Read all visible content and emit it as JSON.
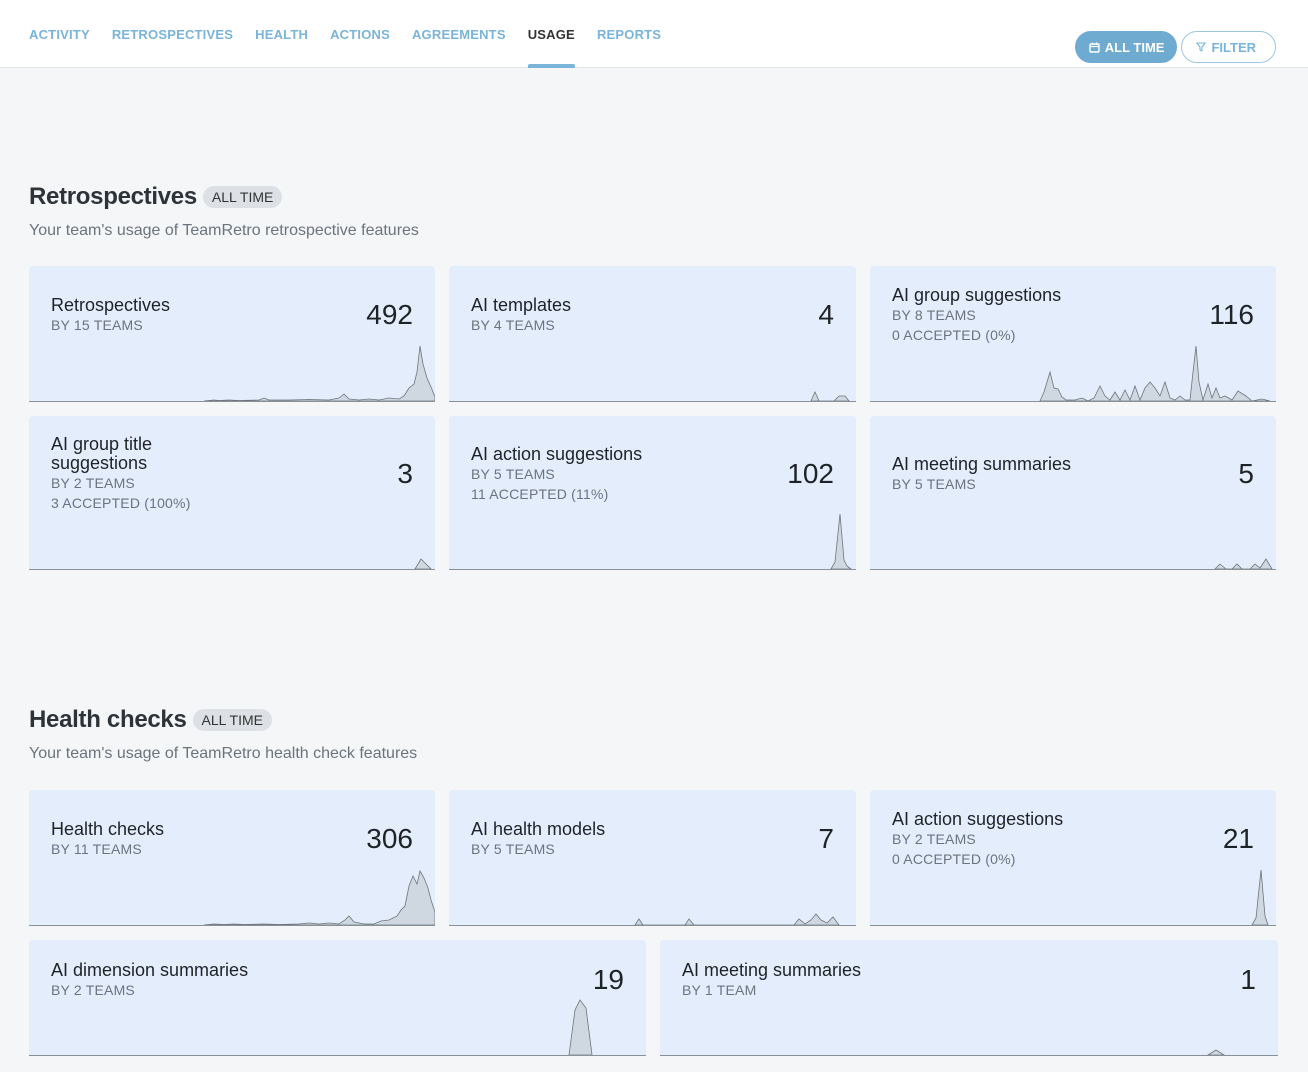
{
  "nav": {
    "tabs": [
      {
        "label": "ACTIVITY",
        "active": false
      },
      {
        "label": "RETROSPECTIVES",
        "active": false
      },
      {
        "label": "HEALTH",
        "active": false
      },
      {
        "label": "ACTIONS",
        "active": false
      },
      {
        "label": "AGREEMENTS",
        "active": false
      },
      {
        "label": "USAGE",
        "active": true
      },
      {
        "label": "REPORTS",
        "active": false
      }
    ],
    "range_button": "ALL TIME",
    "filter_button": "FILTER"
  },
  "colors": {
    "accent": "#7ab4d8",
    "card_bg": "#e3edfb",
    "page_bg": "#f4f6f8"
  },
  "retro": {
    "title": "Retrospectives",
    "badge": "ALL TIME",
    "subtitle": "Your team's usage of TeamRetro retrospective features",
    "cards": [
      {
        "title": "Retrospectives",
        "teams": "BY 15 TEAMS",
        "accepted": "",
        "value": "492"
      },
      {
        "title": "AI templates",
        "teams": "BY 4 TEAMS",
        "accepted": "",
        "value": "4"
      },
      {
        "title": "AI group suggestions",
        "teams": "BY 8 TEAMS",
        "accepted": "0 ACCEPTED (0%)",
        "value": "116"
      },
      {
        "title": "AI group title suggestions",
        "teams": "BY 2 TEAMS",
        "accepted": "3 ACCEPTED (100%)",
        "value": "3"
      },
      {
        "title": "AI action suggestions",
        "teams": "BY 5 TEAMS",
        "accepted": "11 ACCEPTED (11%)",
        "value": "102"
      },
      {
        "title": "AI meeting summaries",
        "teams": "BY 5 TEAMS",
        "accepted": "",
        "value": "5"
      }
    ]
  },
  "health": {
    "title": "Health checks",
    "badge": "ALL TIME",
    "subtitle": "Your team's usage of TeamRetro health check features",
    "cards": [
      {
        "title": "Health checks",
        "teams": "BY 11 TEAMS",
        "accepted": "",
        "value": "306"
      },
      {
        "title": "AI health models",
        "teams": "BY 5 TEAMS",
        "accepted": "",
        "value": "7"
      },
      {
        "title": "AI action suggestions",
        "teams": "BY 2 TEAMS",
        "accepted": "0 ACCEPTED (0%)",
        "value": "21"
      },
      {
        "title": "AI dimension summaries",
        "teams": "BY 2 TEAMS",
        "accepted": "",
        "value": "19"
      },
      {
        "title": "AI meeting summaries",
        "teams": "BY 1 TEAM",
        "accepted": "",
        "value": "1"
      }
    ]
  },
  "icons": {
    "range": "calendar-icon",
    "filter": "filter-icon"
  }
}
